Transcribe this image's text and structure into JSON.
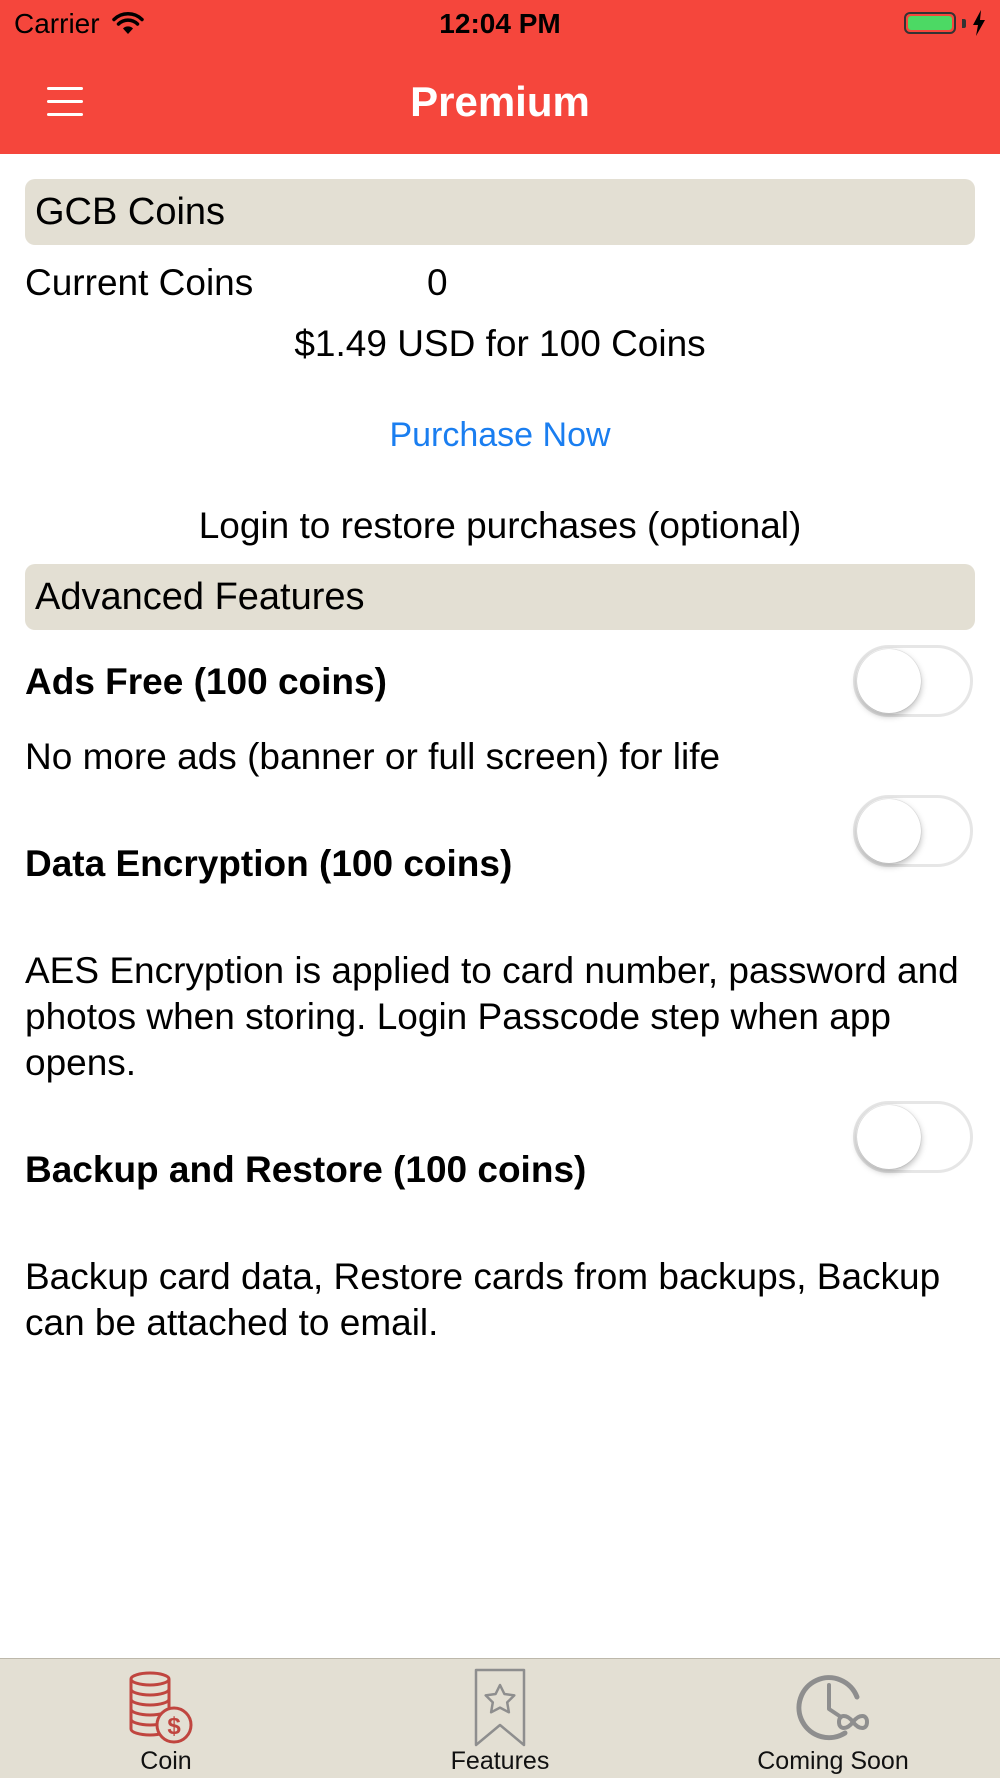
{
  "status_bar": {
    "carrier": "Carrier",
    "time": "12:04 PM"
  },
  "nav": {
    "title": "Premium"
  },
  "coins": {
    "header": "GCB Coins",
    "current_label": "Current Coins",
    "current_value": "0",
    "price_text": "$1.49 USD for 100 Coins",
    "purchase_label": "Purchase Now",
    "login_text": "Login to restore purchases (optional)"
  },
  "features": {
    "header": "Advanced Features",
    "items": [
      {
        "title": "Ads Free (100 coins)",
        "description": "No more ads (banner or full screen) for life",
        "enabled": false
      },
      {
        "title": "Data Encryption (100 coins)",
        "description": "AES Encryption is applied to card number, password and photos when storing. Login Passcode step when app opens.",
        "enabled": false
      },
      {
        "title": "Backup and Restore (100 coins)",
        "description": "Backup card data, Restore cards from backups, Backup can be attached to email.",
        "enabled": false
      }
    ]
  },
  "tabs": [
    {
      "label": "Coin",
      "icon": "coins-dollar-icon",
      "selected": true
    },
    {
      "label": "Features",
      "icon": "bookmark-star-icon",
      "selected": false
    },
    {
      "label": "Coming Soon",
      "icon": "clock-infinity-icon",
      "selected": false
    }
  ],
  "colors": {
    "accent": "#f5463c",
    "link": "#1a7ef0",
    "section_bg": "#e3dfd3",
    "selected_tab_icon": "#c0453f",
    "unselected_tab_icon": "#8e8e8e"
  }
}
